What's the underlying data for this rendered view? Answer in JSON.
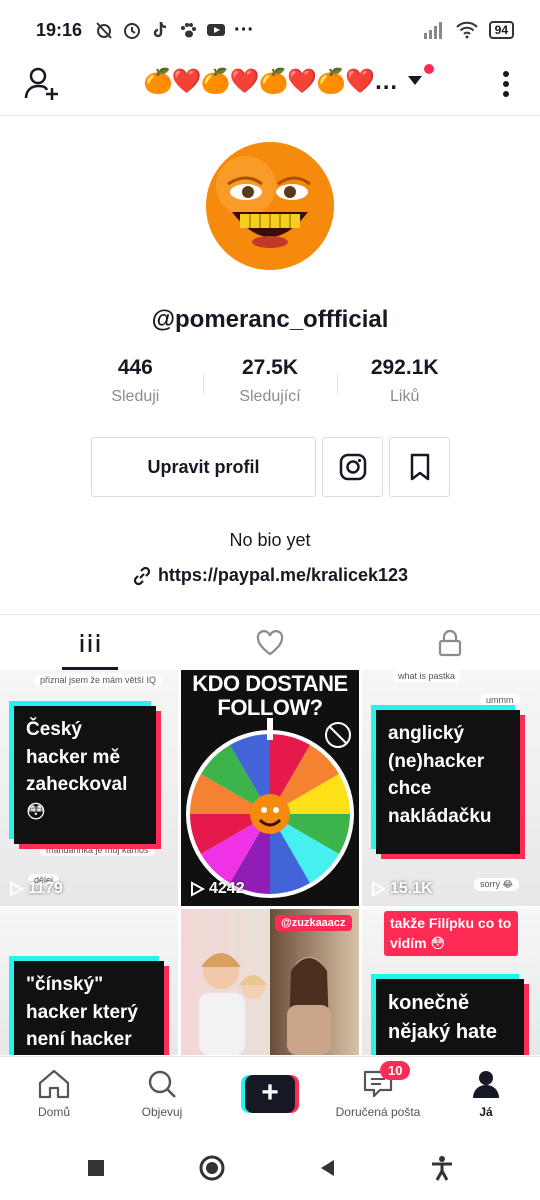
{
  "status_bar": {
    "time": "19:16",
    "dots": "···",
    "battery": "94"
  },
  "header": {
    "title_emojis": [
      "🍊",
      "❤️",
      "🍊",
      "❤️",
      "🍊",
      "❤️",
      "🍊",
      "❤️"
    ],
    "ellipsis": "…",
    "accent": "#fe2c55"
  },
  "profile": {
    "username": "@pomeranc_offficial",
    "stats": [
      {
        "value": "446",
        "label": "Sleduji"
      },
      {
        "value": "27.5K",
        "label": "Sledující"
      },
      {
        "value": "292.1K",
        "label": "Liků"
      }
    ],
    "edit_label": "Upravit profil",
    "bio": "No bio yet",
    "link": "https://paypal.me/kralicek123"
  },
  "videos": [
    {
      "caption": "Český hacker mě zaheckoval 😳",
      "views": "1179",
      "comments": [
        "přiznal jsem že mám větší IQ",
        "mandarinka je můj kámoš",
        "dělej"
      ]
    },
    {
      "caption": "KDO DOSTANE FOLLOW?",
      "views": "4242"
    },
    {
      "caption": "anglický (ne)hacker chce nakládačku",
      "views": "15.1K",
      "comments": [
        "what is pastka",
        "ummm",
        "sorry 😂"
      ]
    },
    {
      "caption": "\"čínský\" hacker který není hacker"
    },
    {
      "caption": "@zuzkaaacz"
    },
    {
      "caption": "konečně nějaký hate",
      "top_note": "takže Filípku co to vidím 😳"
    }
  ],
  "bottom_nav": [
    {
      "label": "Domů"
    },
    {
      "label": "Objevuj"
    },
    {
      "label": "+"
    },
    {
      "label": "Doručená pošta",
      "badge": "10"
    },
    {
      "label": "Já"
    }
  ]
}
